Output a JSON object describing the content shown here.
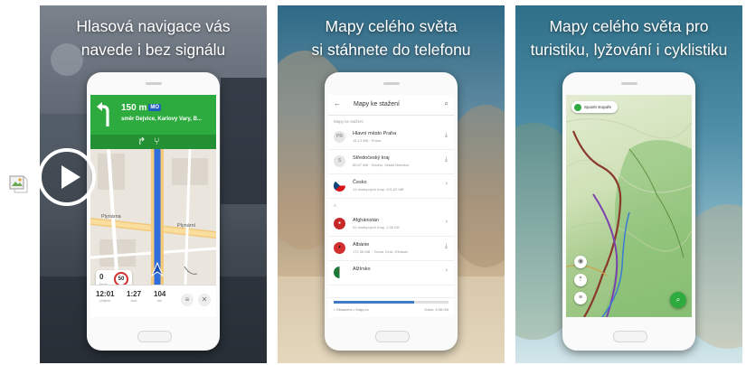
{
  "gallery": {
    "broken_image_icon": "broken-image-icon",
    "play_icon": "play-icon"
  },
  "panel1": {
    "caption_line1": "Hlasová navigace vás",
    "caption_line2": "navede i bez signálu",
    "nav": {
      "distance": "150 m",
      "badge": "MO",
      "street": "směr Dejvice, Karlovy Vary, B...",
      "turn_icon": "turn-left-arrow-icon",
      "road_label_1": "Plynárna",
      "road_label_2": "Plynární",
      "current_speed": "0",
      "speed_unit": "km/h",
      "speed_limit": "50",
      "arrival_time": "12:01",
      "arrival_label": "příjezd",
      "duration": "1:27",
      "duration_label": "hod",
      "remaining_distance": "104",
      "distance_label": "km",
      "menu_icon": "menu-icon",
      "close_icon": "close-icon"
    }
  },
  "panel2": {
    "caption_line1": "Mapy celého světa",
    "caption_line2": "si stáhnete do telefonu",
    "downloads": {
      "title": "Mapy ke stažení",
      "section_label": "Mapy ke stažení",
      "rows": [
        {
          "name": "Hlavní město Praha",
          "sub": "16,13 MB · Praha",
          "action": "download"
        },
        {
          "name": "Středočeský kraj",
          "sub": "86,67 MB · Kladno, Mladá Boleslav",
          "action": "download"
        },
        {
          "name": "Česko",
          "sub": "14 dostupných map, 431,82 MB",
          "action": "chevron"
        },
        {
          "name": "Afghánistán",
          "sub": "34 dostupných map, 1,38 GB",
          "action": "chevron"
        },
        {
          "name": "Albánie",
          "sub": "172,36 MB · Tirana, Drač, Elbasan",
          "action": "download"
        },
        {
          "name": "Alžírsko",
          "sub": "",
          "action": "chevron"
        }
      ],
      "storage_used": "• Obsazeno • Mapy.cz",
      "storage_free": "Volno: 3,98 GB",
      "storage_used_fraction": 0.7
    }
  },
  "panel3": {
    "caption_line1": "Mapy celého světa pro",
    "caption_line2": "turistiku, lyžování i cyklistiku",
    "map": {
      "pill_label": "Spustit stopaře",
      "fab_icon": "search-icon"
    }
  },
  "colors": {
    "green": "#2eab3f",
    "green_dark": "#249034",
    "blue_route": "#2f6ddc",
    "trail_purple": "#7a3fb0",
    "trail_brown": "#8a3a2c"
  }
}
